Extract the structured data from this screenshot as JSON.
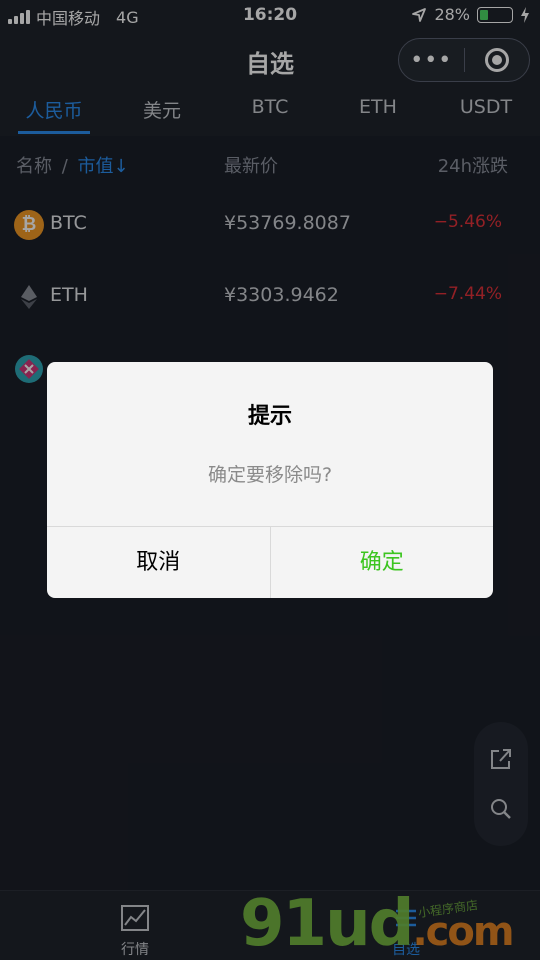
{
  "status_bar": {
    "carrier": "中国移动",
    "network": "4G",
    "time": "16:20",
    "battery": "28%",
    "battery_level": 0.28
  },
  "navbar": {
    "title": "自选",
    "more_glyph": "•••"
  },
  "tabs": [
    {
      "label": "人民币",
      "active": true
    },
    {
      "label": "美元",
      "active": false
    },
    {
      "label": "BTC",
      "active": false
    },
    {
      "label": "ETH",
      "active": false
    },
    {
      "label": "USDT",
      "active": false
    }
  ],
  "list_header": {
    "name": "名称",
    "divider": "/",
    "sort": "市值↓",
    "price": "最新价",
    "change": "24h涨跌"
  },
  "rows": [
    {
      "name": "BTC",
      "price": "¥53769.8087",
      "change": "−5.46%",
      "icon": "bitcoin-icon"
    },
    {
      "name": "ETH",
      "price": "¥3303.9462",
      "change": "−7.44%",
      "icon": "ethereum-icon"
    }
  ],
  "dialog": {
    "title": "提示",
    "message": "确定要移除吗?",
    "cancel": "取消",
    "confirm": "确定"
  },
  "tabbar": {
    "market": "行情",
    "watchlist": "自选"
  },
  "watermark": {
    "brand": "91ud",
    "tld": ".com",
    "tagline": "小程序商店"
  },
  "colors": {
    "accent": "#2c8ef0",
    "down": "#e2323a",
    "confirm": "#3cc51f",
    "background": "#1b1f28"
  }
}
